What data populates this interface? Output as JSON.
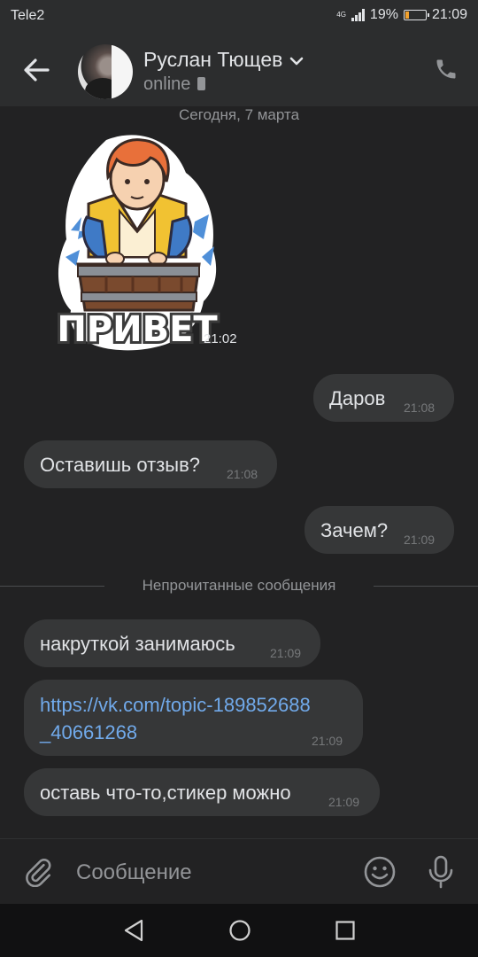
{
  "status": {
    "carrier": "Tele2",
    "network": "4G",
    "battery": "19%",
    "battery_level": 0.19,
    "time": "21:09"
  },
  "header": {
    "contact_name": "Руслан Тющев",
    "presence": "online"
  },
  "chat": {
    "date_separator": "Сегодня, 7 марта",
    "sticker": {
      "text": "ПРИВЕТ",
      "time": "21:02"
    },
    "unread_label": "Непрочитанные сообщения",
    "messages": [
      {
        "direction": "out",
        "text": "Даров",
        "time": "21:08"
      },
      {
        "direction": "in",
        "text": "Оставишь отзыв?",
        "time": "21:08"
      },
      {
        "direction": "out",
        "text": "Зачем?",
        "time": "21:09"
      },
      {
        "direction": "in",
        "text": "накруткой занимаюсь",
        "time": "21:09"
      },
      {
        "direction": "in",
        "text_line1": "https://vk.com/topic-189852688",
        "text_line2": "_40661268",
        "time": "21:09"
      },
      {
        "direction": "in",
        "text": "оставь что-то,стикер можно",
        "time": "21:09"
      }
    ]
  },
  "composer": {
    "placeholder": "Сообщение"
  },
  "icons": {
    "back": "arrow-left-icon",
    "call": "phone-icon",
    "attach": "paperclip-icon",
    "emoji": "smile-icon",
    "voice": "microphone-icon",
    "nav": [
      "nav-back-icon",
      "nav-home-icon",
      "nav-recent-icon"
    ]
  },
  "colors": {
    "background": "#222223",
    "bubble": "#363738",
    "link": "#71aaeb",
    "accent_battery": "#f1a12e"
  }
}
